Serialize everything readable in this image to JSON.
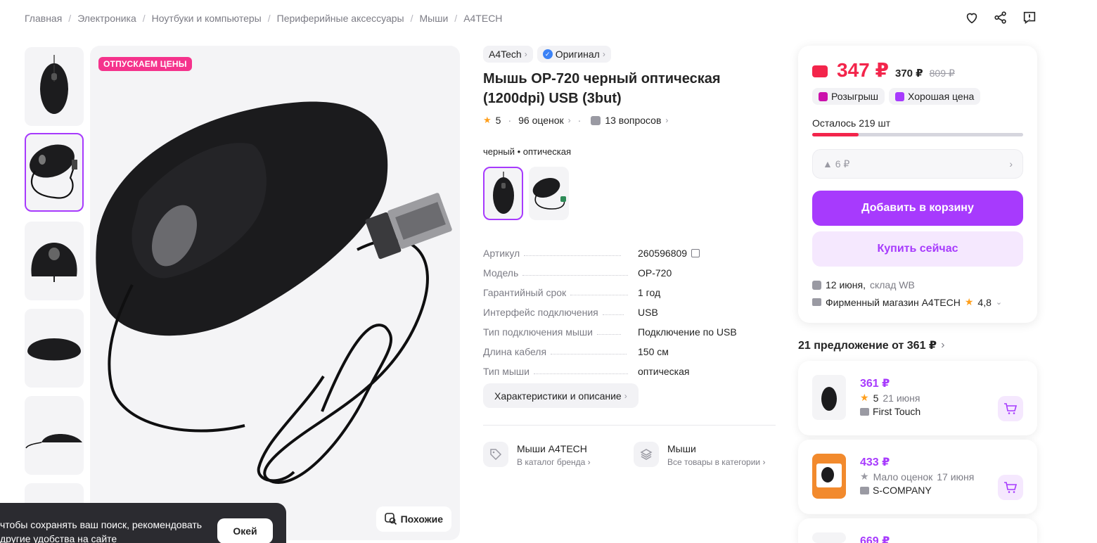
{
  "breadcrumbs": [
    "Главная",
    "Электроника",
    "Ноутбуки и компьютеры",
    "Периферийные аксессуары",
    "Мыши",
    "A4TECH"
  ],
  "gallery": {
    "sale_badge": "ОТПУСКАЕМ ЦЕНЫ",
    "similar_label": "Похожие"
  },
  "product": {
    "brand_chip": "A4Tech",
    "original_chip": "Оригинал",
    "title": "Мышь OP-720 черный оптическая (1200dpi) USB (3but)",
    "rating": "5",
    "reviews": "96 оценок",
    "questions": "13 вопросов",
    "variant_label": "черный • оптическая",
    "specs": [
      {
        "k": "Артикул",
        "v": "260596809"
      },
      {
        "k": "Модель",
        "v": "OP-720"
      },
      {
        "k": "Гарантийный срок",
        "v": "1 год"
      },
      {
        "k": "Интерфейс подключения",
        "v": "USB"
      },
      {
        "k": "Тип подключения мыши",
        "v": "Подключение по USB"
      },
      {
        "k": "Длина кабеля",
        "v": "150 см"
      },
      {
        "k": "Тип мыши",
        "v": "оптическая"
      }
    ],
    "desc_button": "Характеристики и описание",
    "brand_link": {
      "title": "Мыши A4TECH",
      "sub": "В каталог бренда"
    },
    "cat_link": {
      "title": "Мыши",
      "sub": "Все товары в категории"
    }
  },
  "price_card": {
    "price": "347 ₽",
    "price_mid": "370 ₽",
    "price_old": "809 ₽",
    "promo1": "Розыгрыш",
    "promo2": "Хорошая цена",
    "stock": "Осталось 219 шт",
    "stock_fraction": 0.22,
    "discount": "▲ 6 ₽",
    "cart_button": "Добавить в корзину",
    "buy_button": "Купить сейчас",
    "delivery_date": "12 июня,",
    "delivery_place": "склад WB",
    "seller": "Фирменный магазин A4TECH",
    "seller_rating": "4,8"
  },
  "offers": {
    "title": "21 предложение от 361 ₽",
    "items": [
      {
        "price": "361 ₽",
        "rating": "5",
        "date": "21 июня",
        "seller": "First Touch"
      },
      {
        "price": "433 ₽",
        "rating": "Мало оценок",
        "date": "17 июня",
        "seller": "S-COMPANY"
      },
      {
        "price": "669 ₽"
      }
    ]
  },
  "cookie": {
    "line1": "чтобы сохранять ваш поиск, рекомендовать",
    "line2": "другие удобства на сайте",
    "ok": "Окей"
  },
  "colors": {
    "accent": "#a73afd",
    "price": "#f3254b",
    "badge": "#f5338c"
  }
}
